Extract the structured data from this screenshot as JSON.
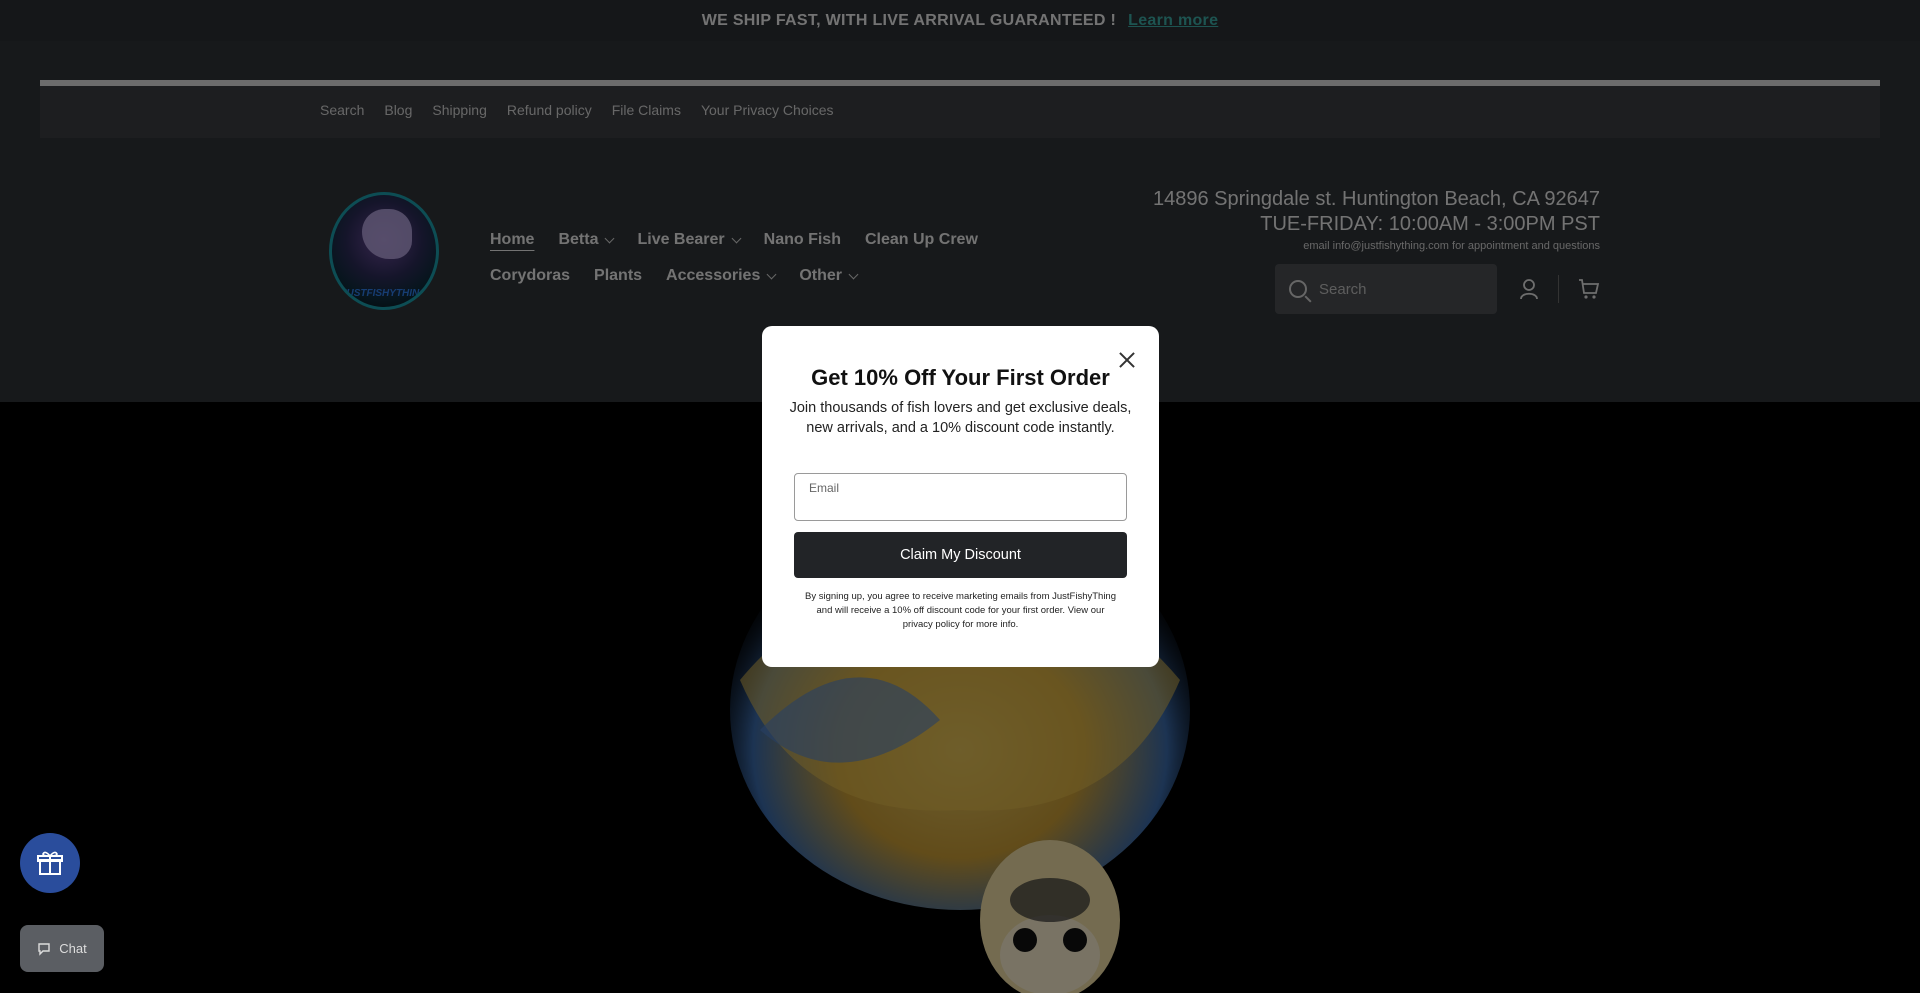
{
  "announcement": {
    "text": "WE SHIP FAST, WITH LIVE ARRIVAL GUARANTEED !",
    "link": "Learn more"
  },
  "utility_nav": [
    "Search",
    "Blog",
    "Shipping",
    "Refund policy",
    "File Claims",
    "Your Privacy Choices"
  ],
  "logo": {
    "text": "JUSTFISHYTHING"
  },
  "main_nav": {
    "row1": [
      {
        "label": "Home",
        "active": true,
        "dropdown": false
      },
      {
        "label": "Betta",
        "dropdown": true
      },
      {
        "label": "Live Bearer",
        "dropdown": true
      },
      {
        "label": "Nano Fish",
        "dropdown": false
      },
      {
        "label": "Clean Up Crew",
        "dropdown": false
      }
    ],
    "row2": [
      {
        "label": "Corydoras",
        "dropdown": false
      },
      {
        "label": "Plants",
        "dropdown": false
      },
      {
        "label": "Accessories",
        "dropdown": true
      },
      {
        "label": "Other",
        "dropdown": true
      }
    ]
  },
  "store_info": {
    "address": "14896 Springdale st. Huntington Beach, CA 92647",
    "hours": "TUE-FRIDAY: 10:00AM - 3:00PM PST",
    "email": "email info@justfishything.com for appointment and questions"
  },
  "search": {
    "placeholder": "Search"
  },
  "icons": {
    "search": "search-icon",
    "account": "account-icon",
    "cart": "cart-icon",
    "close": "close-icon",
    "gift": "gift-icon",
    "chat": "chat-icon"
  },
  "modal": {
    "title": "Get 10% Off Your First Order",
    "subtitle": "Join thousands of fish lovers and get exclusive deals, new arrivals, and a 10% discount code instantly.",
    "email_placeholder": "Email",
    "button": "Claim My Discount",
    "legal": "By signing up, you agree to receive marketing emails from JustFishyThing and will receive a 10% off discount code for your first order. View our privacy policy for more info."
  },
  "chat": {
    "label": "Chat"
  },
  "colors": {
    "accent_link": "#3aa9a2",
    "gift_button": "#2a4d9c",
    "claim_button": "#222427"
  }
}
